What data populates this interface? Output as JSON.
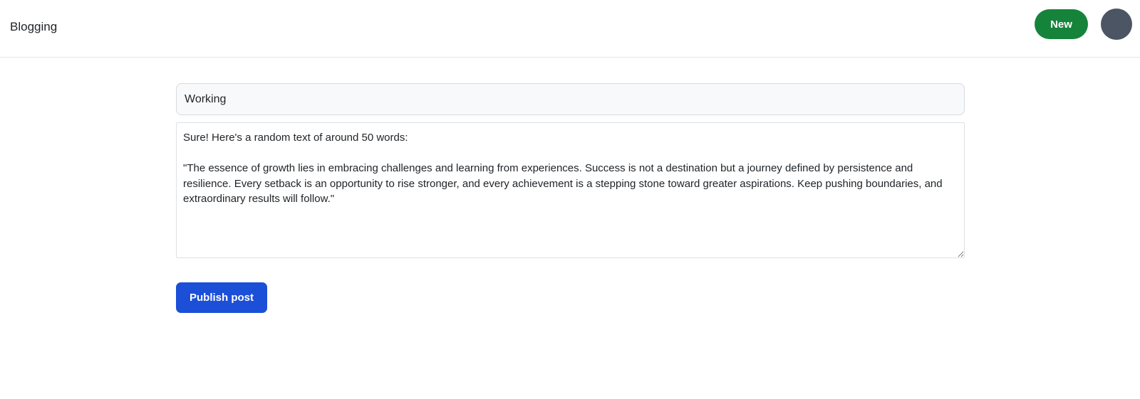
{
  "header": {
    "brand": "Blogging",
    "new_button_label": "New",
    "avatar_name": "avatar"
  },
  "editor": {
    "title_value": "Working",
    "body_value": "Sure! Here's a random text of around 50 words:\n\n\"The essence of growth lies in embracing challenges and learning from experiences. Success is not a destination but a journey defined by persistence and resilience. Every setback is an opportunity to rise stronger, and every achievement is a stepping stone toward greater aspirations. Keep pushing boundaries, and extraordinary results will follow.\""
  },
  "actions": {
    "publish_label": "Publish post"
  },
  "colors": {
    "new_button": "#16833b",
    "avatar": "#4b5563",
    "publish_button": "#1c4fd8",
    "header_border": "#e5e7eb"
  }
}
